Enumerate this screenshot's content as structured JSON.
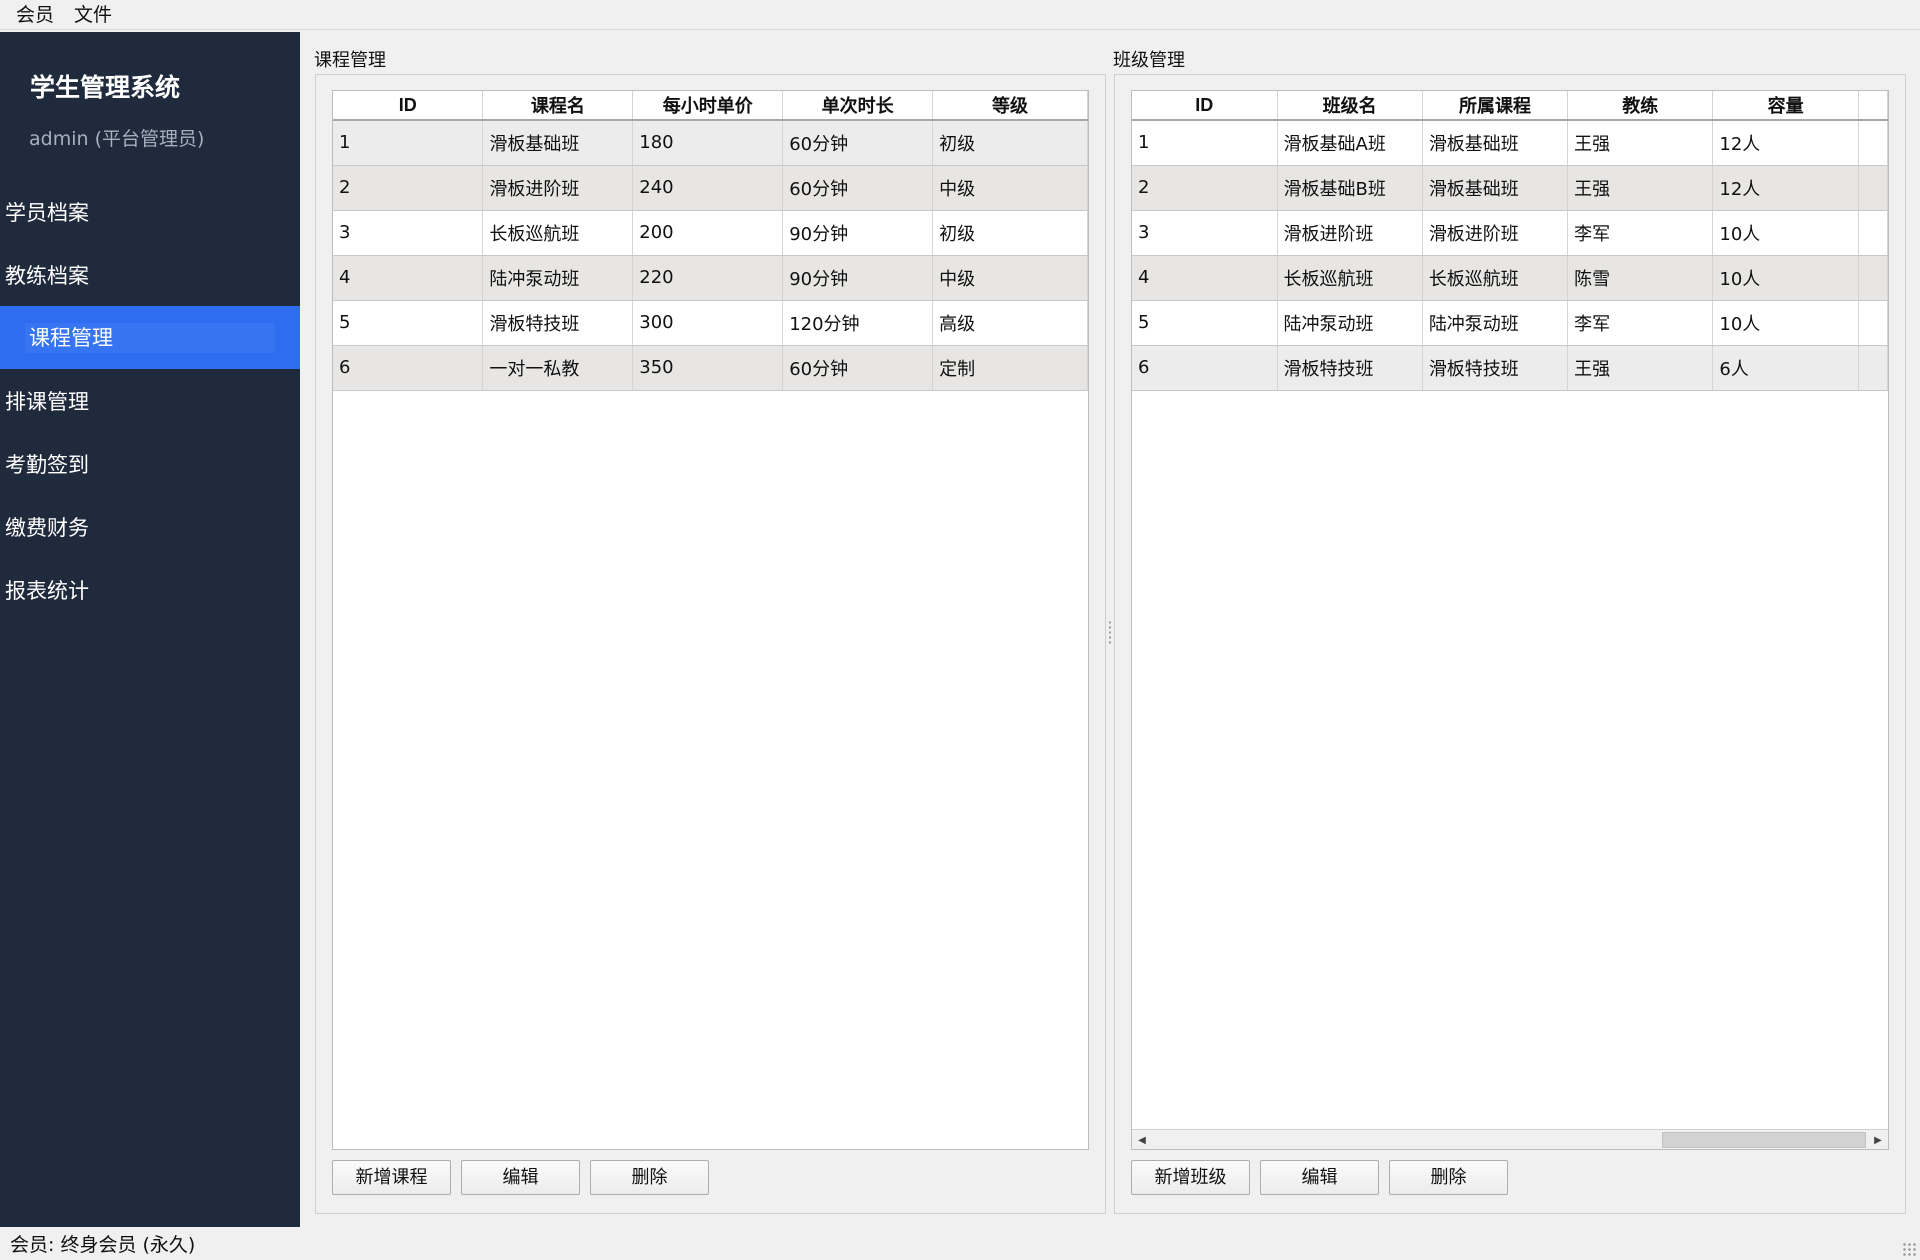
{
  "menu": {
    "items": [
      "会员",
      "文件"
    ]
  },
  "sidebar": {
    "brand": "学生管理系统",
    "user": "admin (平台管理员)",
    "items": [
      {
        "label": "学员档案",
        "active": false
      },
      {
        "label": "教练档案",
        "active": false
      },
      {
        "label": "课程管理",
        "active": true
      },
      {
        "label": "排课管理",
        "active": false
      },
      {
        "label": "考勤签到",
        "active": false
      },
      {
        "label": "缴费财务",
        "active": false
      },
      {
        "label": "报表统计",
        "active": false
      }
    ]
  },
  "courses": {
    "title": "课程管理",
    "columns": [
      "ID",
      "课程名",
      "每小时单价",
      "单次时长",
      "等级"
    ],
    "rows": [
      [
        "1",
        "滑板基础班",
        "180",
        "60分钟",
        "初级"
      ],
      [
        "2",
        "滑板进阶班",
        "240",
        "60分钟",
        "中级"
      ],
      [
        "3",
        "长板巡航班",
        "200",
        "90分钟",
        "初级"
      ],
      [
        "4",
        "陆冲泵动班",
        "220",
        "90分钟",
        "中级"
      ],
      [
        "5",
        "滑板特技班",
        "300",
        "120分钟",
        "高级"
      ],
      [
        "6",
        "一对一私教",
        "350",
        "60分钟",
        "定制"
      ]
    ],
    "buttons": {
      "add": "新增课程",
      "edit": "编辑",
      "delete": "删除"
    }
  },
  "classes": {
    "title": "班级管理",
    "columns": [
      "ID",
      "班级名",
      "所属课程",
      "教练",
      "容量"
    ],
    "rows": [
      [
        "1",
        "滑板基础A班",
        "滑板基础班",
        "王强",
        "12人"
      ],
      [
        "2",
        "滑板基础B班",
        "滑板基础班",
        "王强",
        "12人"
      ],
      [
        "3",
        "滑板进阶班",
        "滑板进阶班",
        "李军",
        "10人"
      ],
      [
        "4",
        "长板巡航班",
        "长板巡航班",
        "陈雪",
        "10人"
      ],
      [
        "5",
        "陆冲泵动班",
        "陆冲泵动班",
        "李军",
        "10人"
      ],
      [
        "6",
        "滑板特技班",
        "滑板特技班",
        "王强",
        "6人"
      ]
    ],
    "buttons": {
      "add": "新增班级",
      "edit": "编辑",
      "delete": "删除"
    }
  },
  "status": {
    "text": "会员: 终身会员 (永久)"
  },
  "colors": {
    "sidebar_bg": "#1f2a3c",
    "active_item": "#2f6df0"
  }
}
